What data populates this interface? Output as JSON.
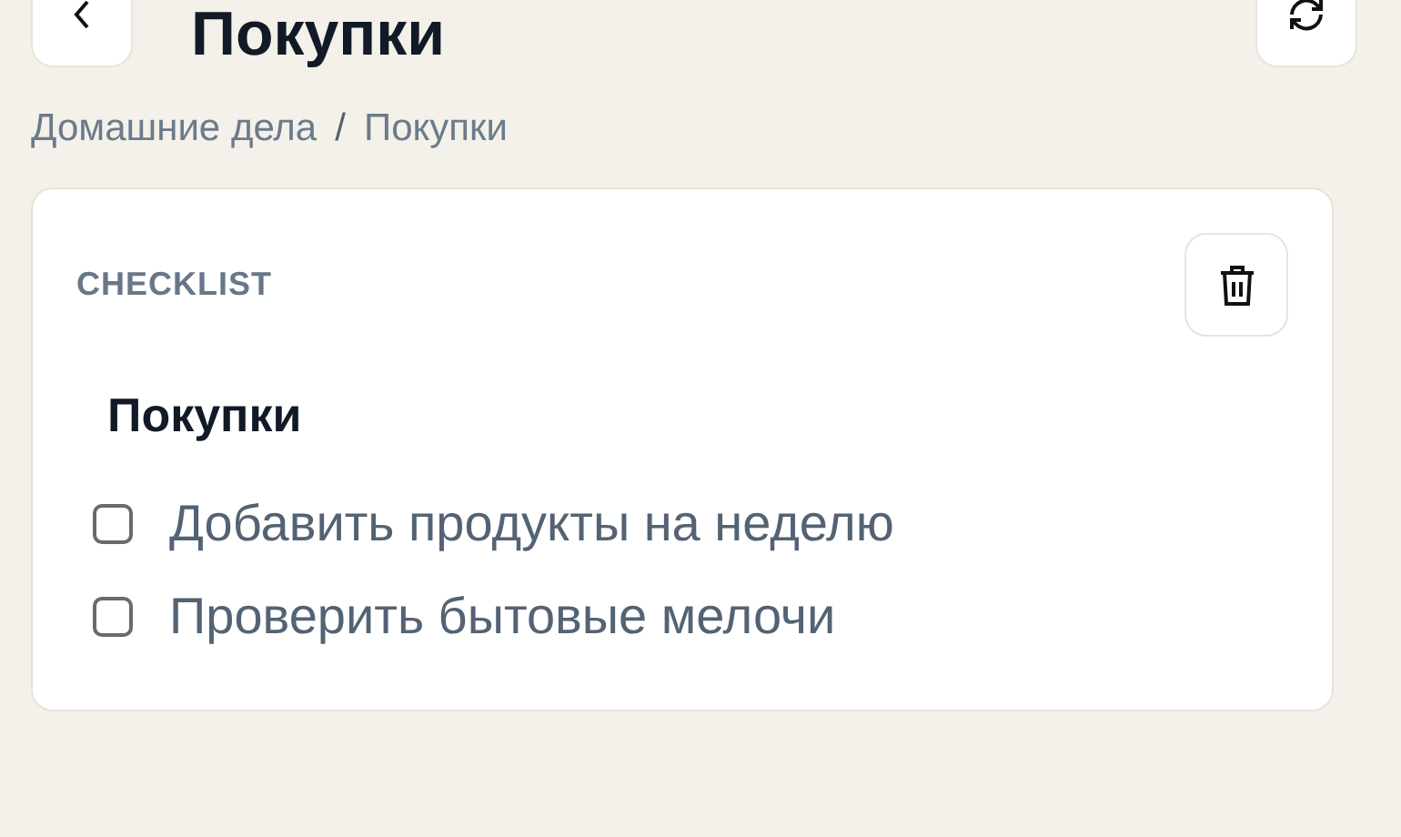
{
  "header": {
    "title": "Покупки"
  },
  "breadcrumb": [
    {
      "text": "Домашние дела"
    },
    {
      "text": "/",
      "kind": "separator"
    },
    {
      "text": "Покупки"
    }
  ],
  "card": {
    "label": "CHECKLIST",
    "title": "Покупки",
    "items": [
      {
        "text": "Добавить продукты на неделю",
        "checked": false
      },
      {
        "text": "Проверить бытовые мелочи",
        "checked": false
      }
    ]
  }
}
